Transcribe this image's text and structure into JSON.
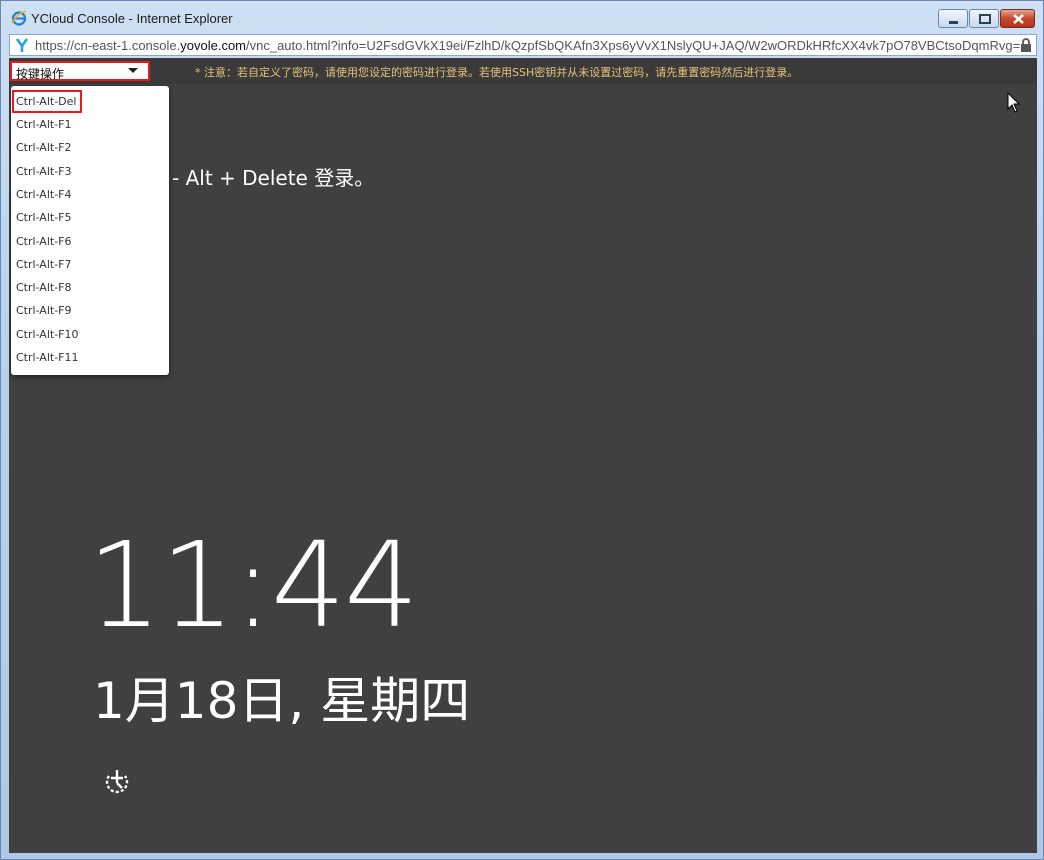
{
  "window": {
    "title": "YCloud Console - Internet Explorer",
    "url_prefix": "https://cn-east-1.console.",
    "url_host": "yovole.com",
    "url_suffix": "/vnc_auto.html?info=U2FsdGVkX19ei/FzlhD/kQzpfSbQKAfn3Xps6yVvX1NslyQU+JAQ/W2wORDkHRfcXX4vk7pO78VBCtsoDqmRvg=="
  },
  "toolbar": {
    "key_select_label": "按键操作",
    "notice": "* 注意：若自定义了密码，请使用您设定的密码进行登录。若使用SSH密钥并从未设置过密码，请先重置密码然后进行登录。"
  },
  "dropdown": {
    "items": [
      "Ctrl-Alt-Del",
      "Ctrl-Alt-F1",
      "Ctrl-Alt-F2",
      "Ctrl-Alt-F3",
      "Ctrl-Alt-F4",
      "Ctrl-Alt-F5",
      "Ctrl-Alt-F6",
      "Ctrl-Alt-F7",
      "Ctrl-Alt-F8",
      "Ctrl-Alt-F9",
      "Ctrl-Alt-F10",
      "Ctrl-Alt-F11"
    ],
    "selected": "Ctrl-Alt-Del"
  },
  "lockscreen": {
    "hint": "- Alt + Delete 登录。",
    "time": "11:44",
    "date": "1月18日, 星期四"
  },
  "colors": {
    "background": "#404040",
    "highlight_border": "#e01c1c",
    "notice_text": "#e6c37a"
  }
}
